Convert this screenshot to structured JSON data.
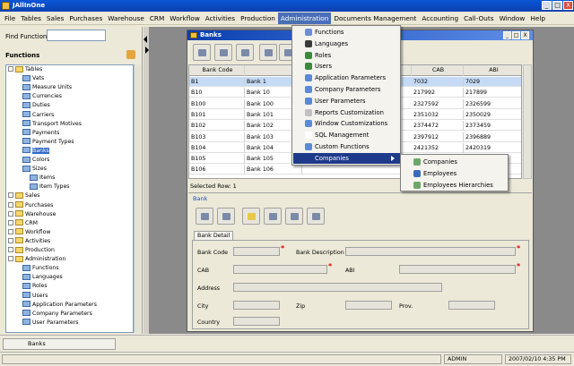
{
  "app": {
    "title": "JAllInOne",
    "controls": [
      "_",
      "□",
      "X"
    ]
  },
  "menubar": [
    "File",
    "Tables",
    "Sales",
    "Purchases",
    "Warehouse",
    "CRM",
    "Workflow",
    "Activities",
    "Production",
    "Administration",
    "Documents Management",
    "Accounting",
    "Call-Outs",
    "Window",
    "Help"
  ],
  "left_panel": {
    "find_label": "Find Function",
    "find_value": "",
    "functions_label": "Functions",
    "tree": [
      {
        "label": "Tables",
        "depth": 0,
        "expanded": true,
        "folder": true
      },
      {
        "label": "Vats",
        "depth": 2,
        "folder": false
      },
      {
        "label": "Measure Units",
        "depth": 2,
        "folder": false
      },
      {
        "label": "Currencies",
        "depth": 2,
        "folder": false
      },
      {
        "label": "Duties",
        "depth": 2,
        "folder": false
      },
      {
        "label": "Carriers",
        "depth": 2,
        "folder": false
      },
      {
        "label": "Transport Motives",
        "depth": 2,
        "folder": false
      },
      {
        "label": "Payments",
        "depth": 2,
        "folder": false
      },
      {
        "label": "Payment Types",
        "depth": 2,
        "folder": false
      },
      {
        "label": "Banks",
        "depth": 2,
        "folder": false,
        "selected": true
      },
      {
        "label": "Colors",
        "depth": 2,
        "folder": false
      },
      {
        "label": "Sizes",
        "depth": 2,
        "folder": false
      },
      {
        "label": "Items",
        "depth": 3,
        "folder": false
      },
      {
        "label": "Item Types",
        "depth": 3,
        "folder": false
      },
      {
        "label": "Sales",
        "depth": 0,
        "folder": true
      },
      {
        "label": "Purchases",
        "depth": 0,
        "folder": true
      },
      {
        "label": "Warehouse",
        "depth": 0,
        "folder": true
      },
      {
        "label": "CRM",
        "depth": 0,
        "folder": true
      },
      {
        "label": "Workflow",
        "depth": 0,
        "folder": true
      },
      {
        "label": "Activities",
        "depth": 0,
        "folder": true
      },
      {
        "label": "Production",
        "depth": 0,
        "folder": true
      },
      {
        "label": "Administration",
        "depth": 0,
        "expanded": true,
        "folder": true
      },
      {
        "label": "Functions",
        "depth": 2,
        "folder": false
      },
      {
        "label": "Languages",
        "depth": 2,
        "folder": false
      },
      {
        "label": "Roles",
        "depth": 2,
        "folder": false
      },
      {
        "label": "Users",
        "depth": 2,
        "folder": false
      },
      {
        "label": "Application Parameters",
        "depth": 2,
        "folder": false
      },
      {
        "label": "Company Parameters",
        "depth": 2,
        "folder": false
      },
      {
        "label": "User Parameters",
        "depth": 2,
        "folder": false
      }
    ]
  },
  "banks_window": {
    "title": "Banks",
    "controls": [
      "_",
      "□",
      "X"
    ],
    "columns": [
      "Bank Code",
      "",
      "",
      "",
      "",
      "",
      "CAB",
      "ABI"
    ],
    "rows": [
      [
        "B1",
        "Bank 1",
        "7032",
        "7029"
      ],
      [
        "B10",
        "Bank 10",
        "217992",
        "217899"
      ],
      [
        "B100",
        "Bank 100",
        "2327592",
        "2326599"
      ],
      [
        "B101",
        "Bank 101",
        "2351032",
        "2350029"
      ],
      [
        "B102",
        "Bank 102",
        "2374472",
        "2373459"
      ],
      [
        "B103",
        "Bank 103",
        "2397912",
        "2396889"
      ],
      [
        "B104",
        "Bank 104",
        "2421352",
        "2420319"
      ],
      [
        "B105",
        "Bank 105",
        "",
        ""
      ],
      [
        "B106",
        "Bank 106",
        "",
        ""
      ]
    ],
    "selected_row_text": "Selected Row: 1",
    "form_title": "Bank",
    "tab": "Bank Detail",
    "fields": {
      "bank_code": "Bank Code",
      "bank_description": "Bank Description",
      "cab": "CAB",
      "abi": "ABI",
      "address": "Address",
      "city": "City",
      "zip": "Zip",
      "prov": "Prov.",
      "country": "Country"
    }
  },
  "admin_menu": {
    "items": [
      "Functions",
      "Languages",
      "Roles",
      "Users",
      "Application Parameters",
      "Company Parameters",
      "User Parameters",
      "Reports Customization",
      "Window Customizations",
      "SQL Management",
      "Custom Functions",
      "Companies"
    ],
    "highlighted": "Companies"
  },
  "companies_submenu": [
    "Companies",
    "Employees",
    "Employees Hierarchies"
  ],
  "taskbar": {
    "button": "Banks"
  },
  "statusbar": {
    "user": "ADMIN",
    "datetime": "2007/02/10 4:35 PM"
  },
  "colors": {
    "title_bar": "#0a4cc4",
    "desktop": "#8a8a8a",
    "selection": "#316ac5",
    "menu_highlight": "#1e3a8a",
    "required": "#e00000"
  }
}
